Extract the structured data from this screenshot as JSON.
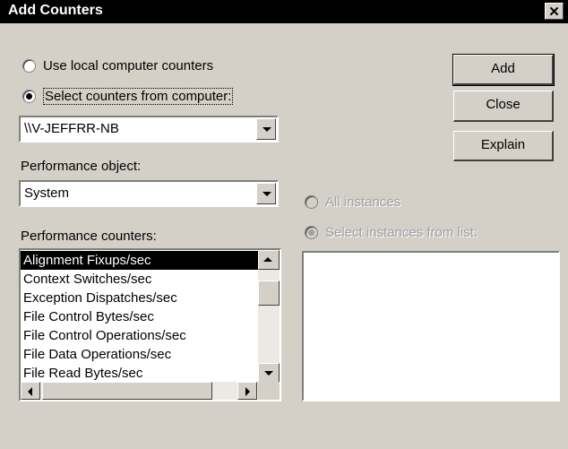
{
  "window": {
    "title": "Add Counters",
    "close_glyph": "✕"
  },
  "source": {
    "local_label": "Use local computer counters",
    "select_label": "Select counters from computer:",
    "computer_value": "\\\\V-JEFFRR-NB"
  },
  "performance_object": {
    "label": "Performance object:",
    "value": "System"
  },
  "performance_counters": {
    "label": "Performance counters:",
    "items": [
      "Alignment Fixups/sec",
      "Context Switches/sec",
      "Exception Dispatches/sec",
      "File Control Bytes/sec",
      "File Control Operations/sec",
      "File Data Operations/sec",
      "File Read Bytes/sec"
    ],
    "selected_index": 0
  },
  "instances": {
    "all_label": "All instances",
    "select_label": "Select instances from list:"
  },
  "buttons": {
    "add": "Add",
    "close": "Close",
    "explain": "Explain"
  },
  "colors": {
    "title_bar": "#000000",
    "dialog_bg": "#d4d0c8",
    "disabled_text": "#a0a0a0"
  }
}
